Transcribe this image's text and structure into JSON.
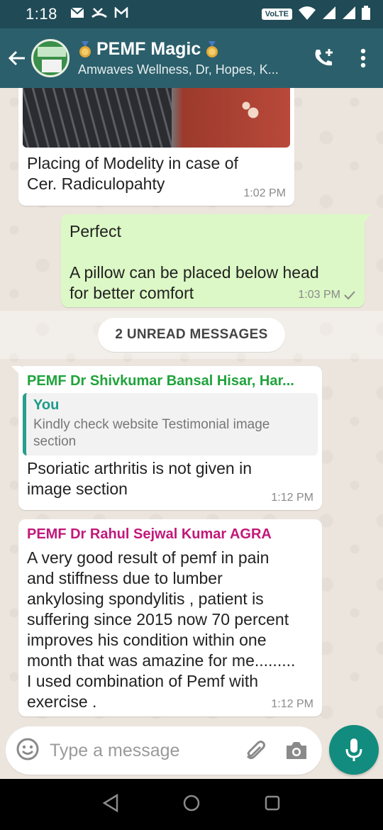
{
  "status_bar": {
    "time": "1:18",
    "volte": "VoLTE",
    "icons": [
      "mail-icon",
      "missed-call-icon",
      "gmail-icon",
      "wifi-icon",
      "signal-icon",
      "battery-icon"
    ]
  },
  "header": {
    "title": "PEMF Magic",
    "subtitle": "Amwaves Wellness, Dr, Hopes, K...",
    "colors": {
      "bar": "#2b5f6b",
      "status": "#1f4a56"
    }
  },
  "messages": [
    {
      "type": "incoming-image",
      "caption_line1": "Placing of Modelity  in case of",
      "caption_line2": "Cer. Radiculopahty",
      "time": "1:02 PM"
    },
    {
      "type": "outgoing",
      "line1": "Perfect",
      "line2": "A pillow can be placed below head",
      "line3": "for better comfort",
      "time": "1:03 PM"
    }
  ],
  "unread_label": "2 UNREAD MESSAGES",
  "incoming": [
    {
      "sender": "PEMF Dr Shivkumar Bansal Hisar, Har...",
      "sender_color": "#1fa33b",
      "quote_name": "You",
      "quote_text_line1": "Kindly check website Testimonial image",
      "quote_text_line2": "section",
      "text_line1": "Psoriatic arthritis is not given in",
      "text_line2": "image section",
      "time": "1:12 PM"
    },
    {
      "sender": "PEMF Dr Rahul Sejwal Kumar AGRA",
      "sender_color": "#c2187a",
      "lines": [
        "A very good result of pemf in pain",
        "and stiffness due to lumber",
        "ankylosing spondylitis , patient is",
        "suffering since 2015 now 70 percent",
        "improves his condition within one",
        "month that was amazine for me.........",
        "I used combination of Pemf with",
        "exercise ."
      ],
      "time": "1:12 PM"
    }
  ],
  "composer": {
    "placeholder": "Type a message"
  }
}
